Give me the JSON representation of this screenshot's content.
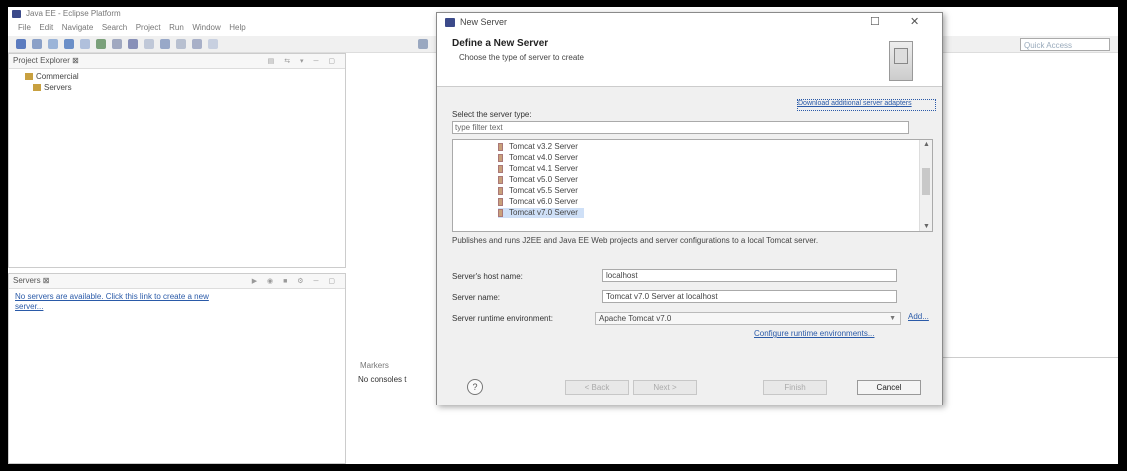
{
  "window": {
    "title": "Java EE - Eclipse Platform"
  },
  "menu": [
    "File",
    "Edit",
    "Navigate",
    "Search",
    "Project",
    "Run",
    "Window",
    "Help"
  ],
  "quick_access": {
    "placeholder": "Quick Access"
  },
  "project_explorer": {
    "tab_label": "Project Explorer ⊠",
    "items": [
      "Commercial",
      "Servers"
    ]
  },
  "servers_view": {
    "tab_label": "Servers ⊠",
    "message": "No servers are available. Click this link to create a new server..."
  },
  "markers_view": {
    "tab_label": "Markers",
    "body": "No consoles t"
  },
  "dialog": {
    "title": "New Server",
    "heading": "Define a New Server",
    "subtitle": "Choose the type of server to create",
    "download_link": "Download additional server adapters",
    "server_type_label": "Select the server type:",
    "filter_placeholder": "type filter text",
    "server_types": [
      "Tomcat v3.2 Server",
      "Tomcat v4.0 Server",
      "Tomcat v4.1 Server",
      "Tomcat v5.0 Server",
      "Tomcat v5.5 Server",
      "Tomcat v6.0 Server",
      "Tomcat v7.0 Server"
    ],
    "selected_server_type": "Tomcat v7.0 Server",
    "description": "Publishes and runs J2EE and Java EE Web projects and server configurations to a local Tomcat server.",
    "host_label": "Server's host name:",
    "host_value": "localhost",
    "name_label": "Server name:",
    "name_value": "Tomcat v7.0 Server at localhost",
    "runtime_label": "Server runtime environment:",
    "runtime_value": "Apache Tomcat v7.0",
    "add_link": "Add...",
    "configure_link": "Configure runtime environments...",
    "help_icon": "question-circle",
    "buttons": {
      "back": "< Back",
      "next": "Next >",
      "finish": "Finish",
      "cancel": "Cancel"
    }
  }
}
